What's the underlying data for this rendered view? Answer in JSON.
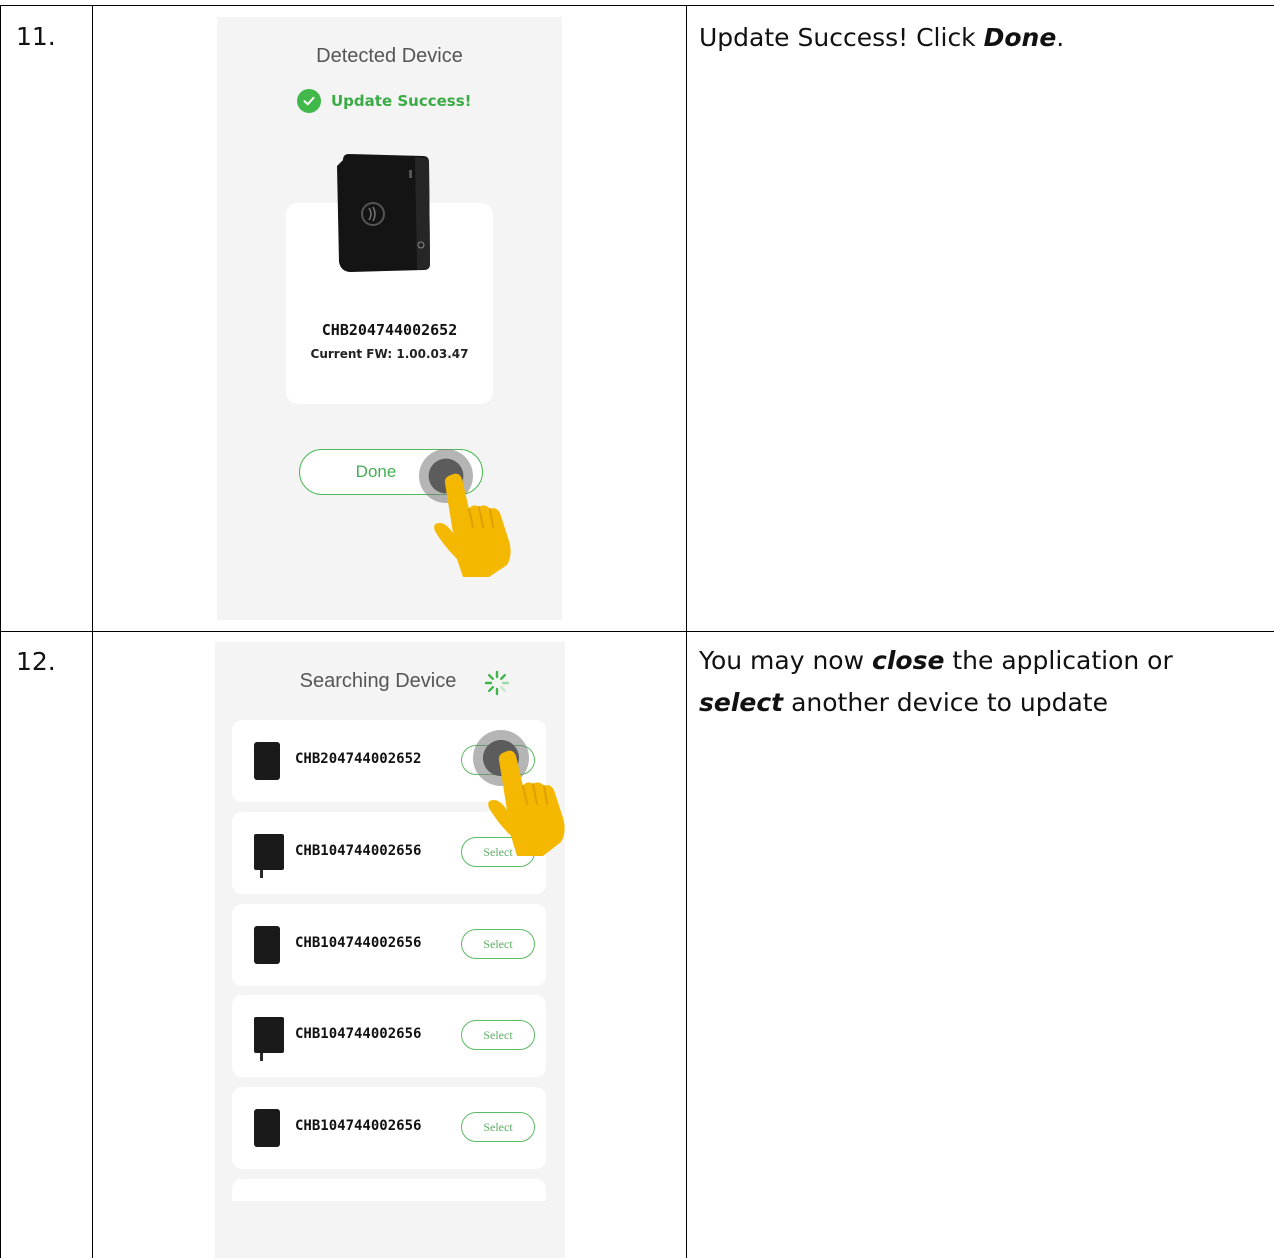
{
  "rows": [
    {
      "step": "11.",
      "description_parts": [
        "Update Success! Click ",
        "Done",
        "."
      ],
      "screen": {
        "title": "Detected Device",
        "status": "Update Success!",
        "serial": "CHB204744002652",
        "firmware": "Current FW: 1.00.03.47",
        "button": "Done"
      }
    },
    {
      "step": "12.",
      "description_parts": [
        "You may now ",
        "close",
        " the application or",
        "select",
        " another device to update"
      ],
      "screen": {
        "title": "Searching Device",
        "devices": [
          {
            "serial": "CHB204744002652",
            "button": "Select"
          },
          {
            "serial": "CHB104744002656",
            "button": "Select"
          },
          {
            "serial": "CHB104744002656",
            "button": "Select"
          },
          {
            "serial": "CHB104744002656",
            "button": "Select"
          },
          {
            "serial": "CHB104744002656",
            "button": "Select"
          }
        ]
      }
    }
  ],
  "colors": {
    "accent_green": "#40b84a",
    "hand_yellow": "#f5b800",
    "screen_bg": "#f4f4f4"
  },
  "icons": [
    "check-circle-icon",
    "loading-spinner-icon",
    "tap-indicator-icon",
    "pointing-hand-icon",
    "device-image"
  ]
}
